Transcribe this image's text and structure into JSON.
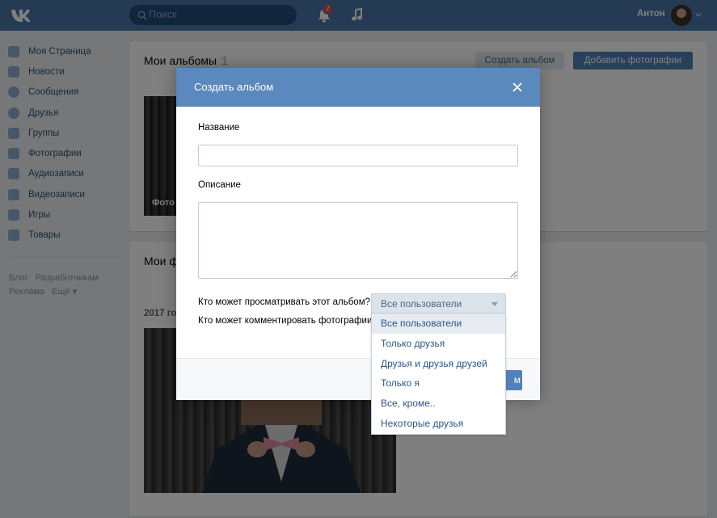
{
  "header": {
    "search_placeholder": "Поиск",
    "notification_count": "2",
    "user_name": "Антон"
  },
  "sidebar": {
    "items": [
      {
        "label": "Моя Страница",
        "icon": "home-icon"
      },
      {
        "label": "Новости",
        "icon": "news-icon"
      },
      {
        "label": "Сообщения",
        "icon": "messages-icon"
      },
      {
        "label": "Друзья",
        "icon": "friends-icon"
      },
      {
        "label": "Группы",
        "icon": "groups-icon"
      },
      {
        "label": "Фотографии",
        "icon": "camera-icon"
      },
      {
        "label": "Аудиозаписи",
        "icon": "music-icon"
      },
      {
        "label": "Видеозаписи",
        "icon": "video-icon"
      },
      {
        "label": "Игры",
        "icon": "gamepad-icon"
      },
      {
        "label": "Товары",
        "icon": "bag-icon"
      }
    ],
    "footer_links": [
      "Блог",
      "Разработчикам",
      "Реклама",
      "Ещё ▾"
    ]
  },
  "albums": {
    "title": "Мои альбомы",
    "count": "1",
    "create_album_label": "Создать альбом",
    "add_photos_label": "Добавить фотографии",
    "thumb_caption": "Фото"
  },
  "photos": {
    "title": "Мои ф",
    "year_label": "2017 го"
  },
  "modal": {
    "title": "Создать альбом",
    "name_label": "Название",
    "description_label": "Описание",
    "view_privacy_label": "Кто может просматривать этот альбом?",
    "comment_privacy_label": "Кто может комментировать фотографии?",
    "save_label": "м"
  },
  "privacy_select": {
    "selected": "Все пользователи",
    "options": [
      "Все пользователи",
      "Только друзья",
      "Друзья и друзья друзей",
      "Только я",
      "Все, кроме..",
      "Некоторые друзья"
    ]
  },
  "colors": {
    "header_bg": "#4a76a8",
    "modal_header_bg": "#5b88bd",
    "primary_button": "#5181b8",
    "link_text": "#2a5885"
  }
}
